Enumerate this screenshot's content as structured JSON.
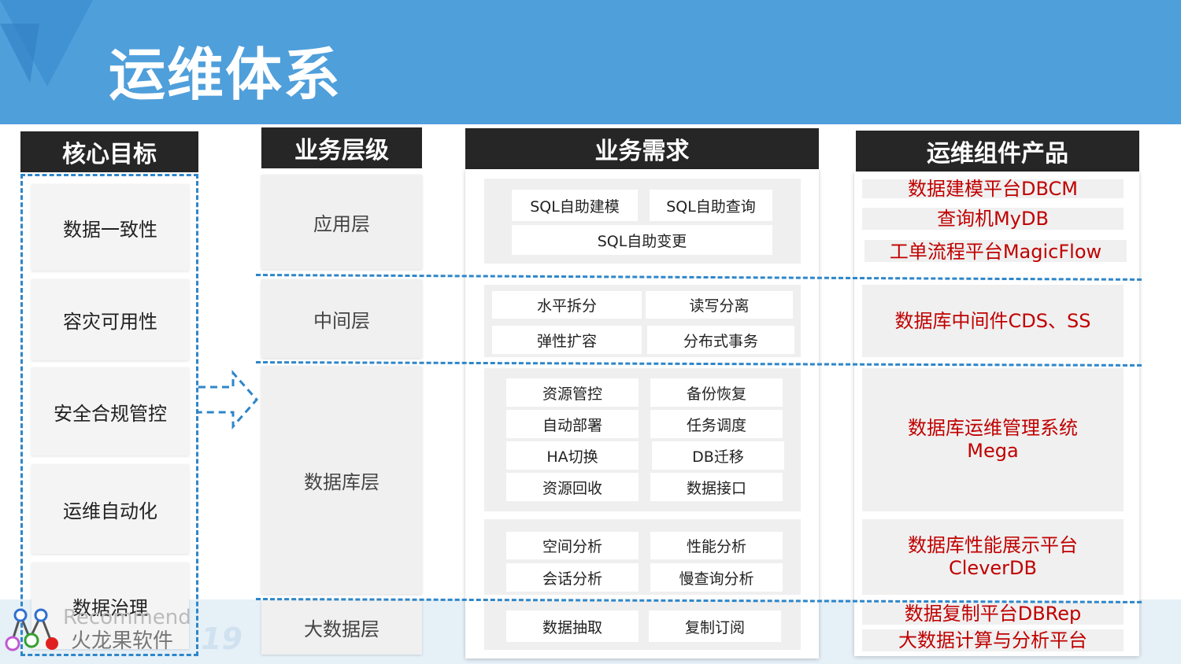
{
  "title": "运维体系",
  "colors": {
    "banner": "#4f9fdb",
    "header_bg": "#262626",
    "dash": "#2f86c9",
    "product_text": "#c00000"
  },
  "columns": {
    "targets": "核心目标",
    "layers": "业务层级",
    "needs": "业务需求",
    "products": "运维组件产品"
  },
  "targets": [
    "数据一致性",
    "容灾可用性",
    "安全合规管控",
    "运维自动化",
    "数据治理"
  ],
  "layers": {
    "app": "应用层",
    "middle": "中间层",
    "db": "数据库层",
    "bigdata": "大数据层"
  },
  "needs": {
    "app": [
      "SQL自助建模",
      "SQL自助查询",
      "SQL自助变更"
    ],
    "middle": [
      "水平拆分",
      "读写分离",
      "弹性扩容",
      "分布式事务"
    ],
    "db_ops": [
      "资源管控",
      "备份恢复",
      "自动部署",
      "任务调度",
      "HA切换",
      "DB迁移",
      "资源回收",
      "数据接口"
    ],
    "db_perf": [
      "空间分析",
      "性能分析",
      "会话分析",
      "慢查询分析"
    ],
    "bigdata": [
      "数据抽取",
      "复制订阅"
    ]
  },
  "products": {
    "app": [
      "数据建模平台DBCM",
      "查询机MyDB",
      "工单流程平台MagicFlow"
    ],
    "middle": "数据库中间件CDS、SS",
    "db_ops": "数据库运维管理系统\nMega",
    "db_perf": "数据库性能展示平台\nCleverDB",
    "bigdata": [
      "数据复制平台DBRep",
      "大数据计算与分析平台"
    ]
  },
  "watermark": {
    "brand_en": "Recommend",
    "brand_cn": "火龙果软件",
    "year_fragment": "19"
  },
  "icons": {
    "arrow": "dashed-right-arrow-icon",
    "logo": "graph-nodes-logo-icon",
    "decor": "triangle-decor-icon"
  }
}
